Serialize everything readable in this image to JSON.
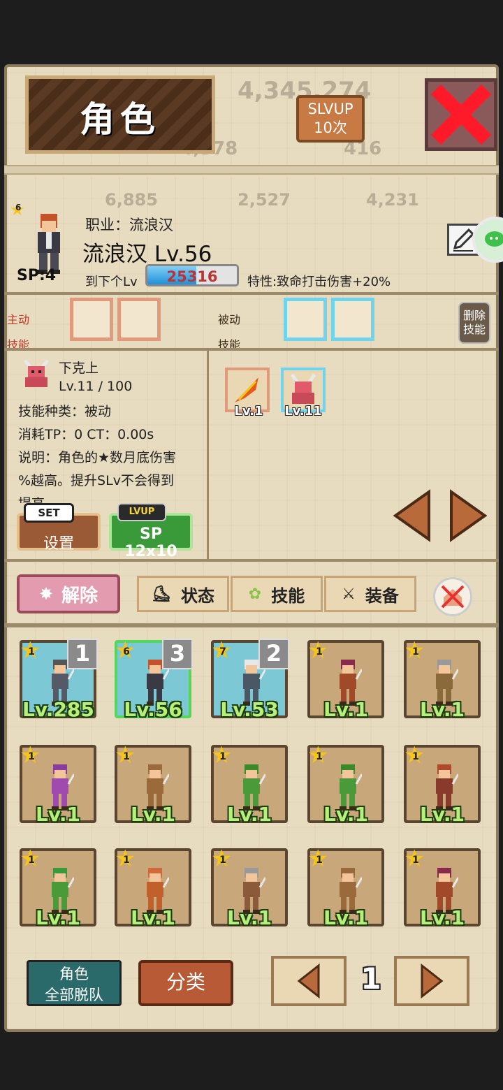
{
  "title": "角色",
  "slvup": {
    "line1": "SLVUP",
    "line2": "10次"
  },
  "bg_numbers": [
    "4,345,274",
    "4,378",
    "416",
    "6,885",
    "2,527",
    "4,231"
  ],
  "character": {
    "stars": "6",
    "sp": "SP:4",
    "job": "职业：流浪汉",
    "name_level": "流浪汉 Lv.56",
    "next_label": "到下个Lv",
    "exp_value": "25316",
    "exp_progress": 0.55,
    "trait": "特性:致命打击伤害+20%"
  },
  "skills": {
    "active_label_1": "主动",
    "active_label_2": "技能",
    "passive_label_1": "被动",
    "passive_label_2": "技能",
    "remove_1": "删除",
    "remove_2": "技能"
  },
  "skill_detail": {
    "name": "下克上",
    "level": "Lv.11 / 100",
    "type": "技能种类：被动",
    "cost": "消耗TP：0   CT：0.00s",
    "desc_1": "说明：角色的★数月底伤害",
    "desc_2": "%越高。提升SLv不会得到",
    "desc_3": "提高"
  },
  "skill_buttons": {
    "set_tag": "SET",
    "set_label": "设置",
    "lvup_tag": "LVUP",
    "lvup_label": "SP 12x10"
  },
  "owned_skills": [
    {
      "lv": "Lv.1",
      "icon": "fire-feather-icon"
    },
    {
      "lv": "Lv.11",
      "icon": "demon-icon"
    }
  ],
  "tabs": {
    "release": "解除",
    "status": "状态",
    "skill": "技能",
    "equip": "装备"
  },
  "roster": [
    {
      "star": "1",
      "lv": "Lv.285",
      "num": "1",
      "bg": "blue",
      "hair": "#555555",
      "outfit": "#555a66"
    },
    {
      "star": "6",
      "lv": "Lv.56",
      "num": "3",
      "bg": "blue",
      "hair": "#c4532a",
      "outfit": "#3a3a44",
      "selected": true
    },
    {
      "star": "7",
      "lv": "Lv.53",
      "num": "2",
      "bg": "blue",
      "hair": "#e8e8e8",
      "outfit": "#4a5866"
    },
    {
      "star": "1",
      "lv": "Lv.1",
      "bg": "brown",
      "hair": "#8a2a4a",
      "outfit": "#a04a2a"
    },
    {
      "star": "1",
      "lv": "Lv.1",
      "bg": "brown",
      "hair": "#999999",
      "outfit": "#8a6a3a"
    },
    {
      "star": "1",
      "lv": "Lv.1",
      "bg": "brown",
      "hair": "#8a3aa0",
      "outfit": "#a04ab0"
    },
    {
      "star": "1",
      "lv": "Lv.1",
      "bg": "brown",
      "hair": "#9a6a3a",
      "outfit": "#9a6a3a"
    },
    {
      "star": "1",
      "lv": "Lv.1",
      "bg": "brown",
      "hair": "#3a8a2a",
      "outfit": "#4a9a3a"
    },
    {
      "star": "1",
      "lv": "Lv.1",
      "bg": "brown",
      "hair": "#3a8a2a",
      "outfit": "#4a9a3a"
    },
    {
      "star": "1",
      "lv": "Lv.1",
      "bg": "brown",
      "hair": "#b04a2a",
      "outfit": "#8a3a2a"
    },
    {
      "star": "1",
      "lv": "Lv.1",
      "bg": "brown",
      "hair": "#3a9a3a",
      "outfit": "#4a9a3a"
    },
    {
      "star": "1",
      "lv": "Lv.1",
      "bg": "brown",
      "hair": "#d06a3a",
      "outfit": "#c0602a"
    },
    {
      "star": "1",
      "lv": "Lv.1",
      "bg": "brown",
      "hair": "#999999",
      "outfit": "#8a5a3a"
    },
    {
      "star": "1",
      "lv": "Lv.1",
      "bg": "brown",
      "hair": "#9a6a3a",
      "outfit": "#9a6a3a"
    },
    {
      "star": "1",
      "lv": "Lv.1",
      "bg": "brown",
      "hair": "#8a2a4a",
      "outfit": "#a04a2a"
    }
  ],
  "bottom": {
    "team_line1": "角色",
    "team_line2": "全部脱队",
    "sort": "分类",
    "page": "1"
  }
}
